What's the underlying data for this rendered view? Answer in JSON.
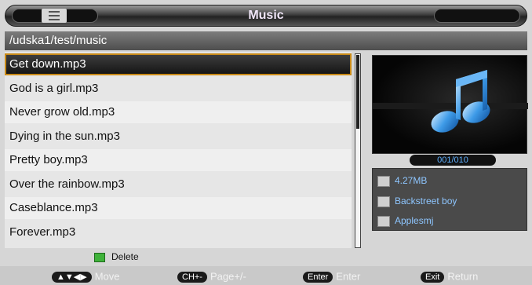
{
  "header": {
    "title": "Music"
  },
  "path": "/udska1/test/music",
  "files": [
    {
      "name": "Get down.mp3",
      "selected": true
    },
    {
      "name": "God is a girl.mp3"
    },
    {
      "name": "Never grow old.mp3"
    },
    {
      "name": "Dying in the sun.mp3"
    },
    {
      "name": "Pretty boy.mp3"
    },
    {
      "name": "Over the rainbow.mp3"
    },
    {
      "name": "Caseblance.mp3"
    },
    {
      "name": "Forever.mp3"
    }
  ],
  "player": {
    "counter": "001/010",
    "size": "4.27MB",
    "artist": "Backstreet boy",
    "album": "Applesmj",
    "size_icon": "file-size-icon",
    "artist_icon": "artist-icon",
    "album_icon": "album-icon"
  },
  "actions": {
    "delete_label": "Delete",
    "delete_color": "#3fb23a"
  },
  "footer": {
    "move_key": "▲▼◀▶",
    "move_label": "Move",
    "page_key": "CH+-",
    "page_label": "Page+/-",
    "enter_key": "Enter",
    "enter_label": "Enter",
    "exit_key": "Exit",
    "exit_label": "Return"
  },
  "colors": {
    "selection_border": "#c98a17",
    "accent_text": "#5fb0ff"
  }
}
